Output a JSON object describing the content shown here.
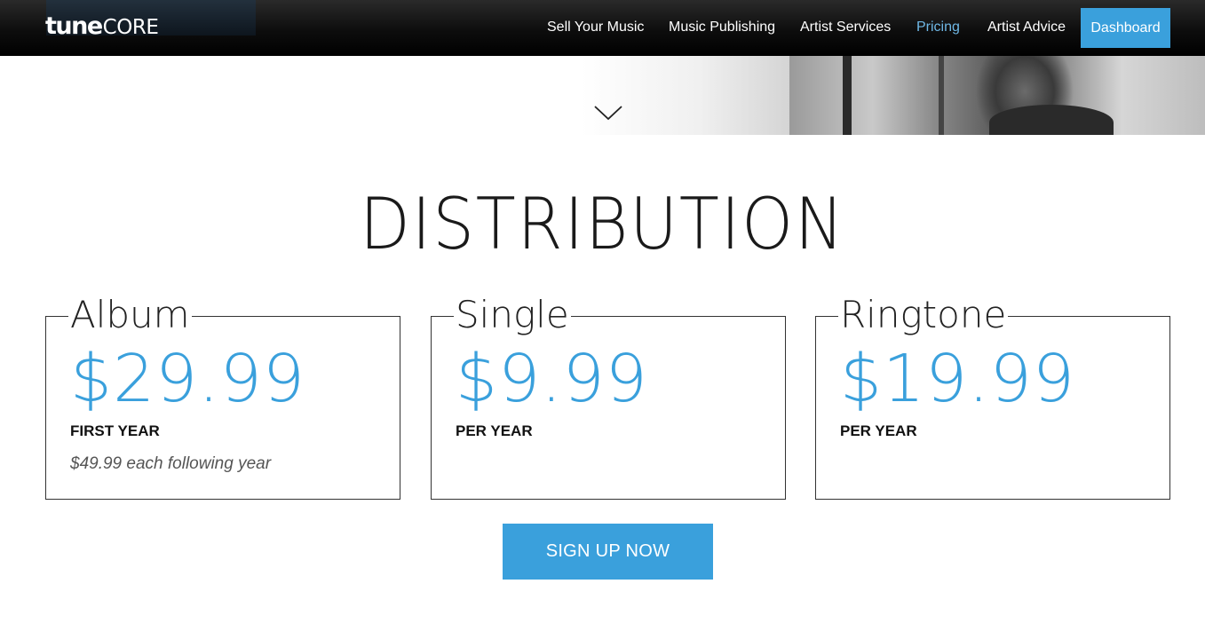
{
  "header": {
    "logo": {
      "part1": "tune",
      "part2": "CORE"
    },
    "nav": [
      {
        "label": "Sell Your Music",
        "active": false
      },
      {
        "label": "Music Publishing",
        "active": false
      },
      {
        "label": "Artist Services",
        "active": false
      },
      {
        "label": "Pricing",
        "active": true
      },
      {
        "label": "Artist Advice",
        "active": false
      }
    ],
    "dashboard_label": "Dashboard"
  },
  "hero": {
    "scroll_icon": "chevron-down-icon"
  },
  "section": {
    "title": "DISTRIBUTION",
    "cards": [
      {
        "name": "Album",
        "price": "$29.99",
        "term": "FIRST YEAR",
        "note": "$49.99 each following year"
      },
      {
        "name": "Single",
        "price": "$9.99",
        "term": "PER YEAR",
        "note": ""
      },
      {
        "name": "Ringtone",
        "price": "$19.99",
        "term": "PER YEAR",
        "note": ""
      }
    ],
    "signup_label": "SIGN UP NOW"
  },
  "colors": {
    "accent": "#3aa0dc",
    "active_nav": "#6fb8e6",
    "header_bg": "#000000"
  }
}
